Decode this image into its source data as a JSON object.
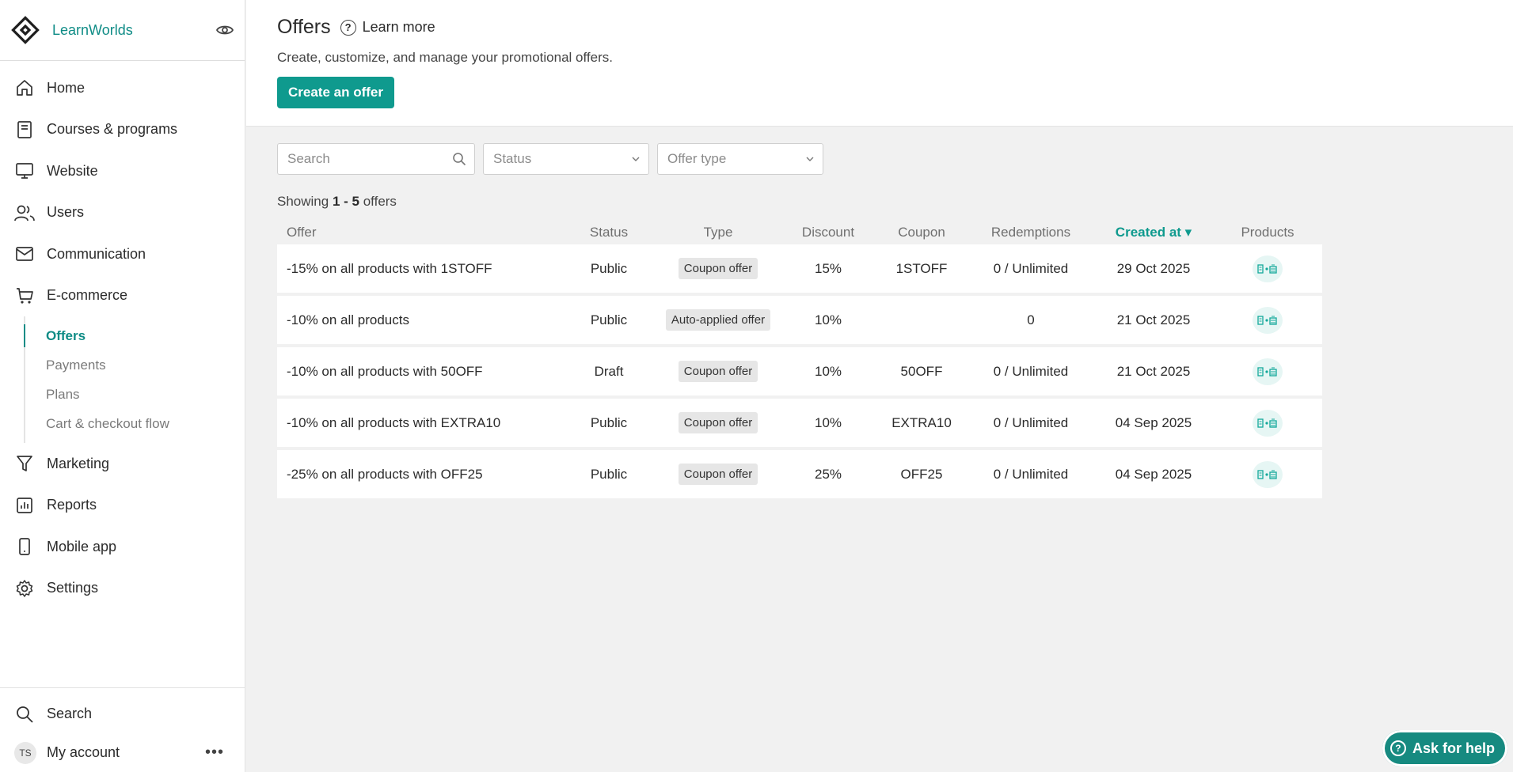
{
  "brand": {
    "name": "LearnWorlds"
  },
  "nav": {
    "items": [
      {
        "label": "Home",
        "icon": "home-icon"
      },
      {
        "label": "Courses & programs",
        "icon": "book-icon"
      },
      {
        "label": "Website",
        "icon": "monitor-icon"
      },
      {
        "label": "Users",
        "icon": "users-icon"
      },
      {
        "label": "Communication",
        "icon": "mail-icon"
      },
      {
        "label": "E-commerce",
        "icon": "cart-icon"
      }
    ],
    "ecommerce_sub": [
      {
        "label": "Offers",
        "active": true
      },
      {
        "label": "Payments"
      },
      {
        "label": "Plans"
      },
      {
        "label": "Cart & checkout flow"
      }
    ],
    "items_after": [
      {
        "label": "Marketing",
        "icon": "funnel-icon"
      },
      {
        "label": "Reports",
        "icon": "chart-icon"
      },
      {
        "label": "Mobile app",
        "icon": "phone-icon"
      },
      {
        "label": "Settings",
        "icon": "gear-icon"
      }
    ],
    "bottom": {
      "search": "Search",
      "account": "My account",
      "avatar_initials": "TS"
    }
  },
  "header": {
    "title": "Offers",
    "learn_more": "Learn more",
    "subtitle": "Create, customize, and manage your promotional offers.",
    "create_button": "Create an offer"
  },
  "filters": {
    "search_placeholder": "Search",
    "status_placeholder": "Status",
    "offer_type_placeholder": "Offer type"
  },
  "showing": {
    "prefix": "Showing",
    "range": "1 - 5",
    "suffix": "offers"
  },
  "table": {
    "columns": {
      "offer": "Offer",
      "status": "Status",
      "type": "Type",
      "discount": "Discount",
      "coupon": "Coupon",
      "redemptions": "Redemptions",
      "created": "Created at ▾",
      "products": "Products"
    },
    "rows": [
      {
        "offer": "-15% on all products with 1STOFF",
        "status": "Public",
        "type": "Coupon offer",
        "discount": "15%",
        "coupon": "1STOFF",
        "redemptions": "0 / Unlimited",
        "created": "29 Oct 2025"
      },
      {
        "offer": "-10% on all products",
        "status": "Public",
        "type": "Auto-applied offer",
        "discount": "10%",
        "coupon": "",
        "redemptions": "0",
        "created": "21 Oct 2025"
      },
      {
        "offer": "-10% on all products with 50OFF",
        "status": "Draft",
        "type": "Coupon offer",
        "discount": "10%",
        "coupon": "50OFF",
        "redemptions": "0 / Unlimited",
        "created": "21 Oct 2025"
      },
      {
        "offer": "-10% on all products with EXTRA10",
        "status": "Public",
        "type": "Coupon offer",
        "discount": "10%",
        "coupon": "EXTRA10",
        "redemptions": "0 / Unlimited",
        "created": "04 Sep 2025"
      },
      {
        "offer": "-25% on all products with OFF25",
        "status": "Public",
        "type": "Coupon offer",
        "discount": "25%",
        "coupon": "OFF25",
        "redemptions": "0 / Unlimited",
        "created": "04 Sep 2025"
      }
    ]
  },
  "help": {
    "label": "Ask for help"
  },
  "colors": {
    "accent": "#0f9a8e",
    "brand_text": "#0f8c86",
    "background": "#f1f1f1"
  }
}
